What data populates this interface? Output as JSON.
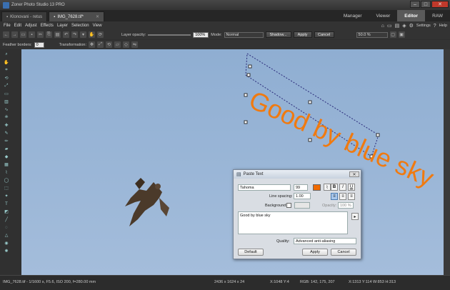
{
  "titlebar": {
    "title": "Zoner Photo Studio 13 PRO"
  },
  "tabs": [
    {
      "label": "Klonovani - retus"
    },
    {
      "label": "IMG_7628.tif*"
    }
  ],
  "modes": [
    "Manager",
    "Viewer",
    "Editor",
    "RAW"
  ],
  "menu": [
    "File",
    "Edit",
    "Adjust",
    "Effects",
    "Layer",
    "Selection",
    "View"
  ],
  "rightmenu": {
    "settings": "Settings",
    "help": "Help"
  },
  "toolbar1": {
    "layer_opacity_label": "Layer opacity:",
    "layer_opacity_value": "100%",
    "mode_label": "Mode:",
    "mode_value": "Normal",
    "shadow_label": "Shadow...",
    "apply_label": "Apply",
    "cancel_label": "Cancel",
    "zoom_value": "50.0 %"
  },
  "toolbar2": {
    "feather_label": "Feather borders:",
    "feather_value": "0",
    "transformation_label": "Transformation:"
  },
  "canvas": {
    "overlay_text": "Good by blue sky",
    "text_color": "#f07a10"
  },
  "dialog": {
    "title": "Paste Text",
    "font": "Tahoma",
    "size": "99",
    "color": "#f06a00",
    "line_spacing_label": "Line spacing:",
    "line_spacing_value": "1.00",
    "background_label": "Background:",
    "opacity_label": "Opacity:",
    "opacity_value": "100 %",
    "text": "Good by blue sky",
    "quality_label": "Quality:",
    "quality_value": "Advanced anti-aliasing",
    "default_label": "Default",
    "apply_label": "Apply",
    "cancel_label": "Cancel"
  },
  "status": {
    "info": "IMG_7628.tif - 1/1600 s, F5.6, ISO 200, f=280.00 mm",
    "size": "2436 x 1624 x 24",
    "coords": "X:1048 Y:4",
    "rgb": "RGB: 142, 175, 207",
    "sel": "X:1313  Y:114  W:853  H:313"
  }
}
